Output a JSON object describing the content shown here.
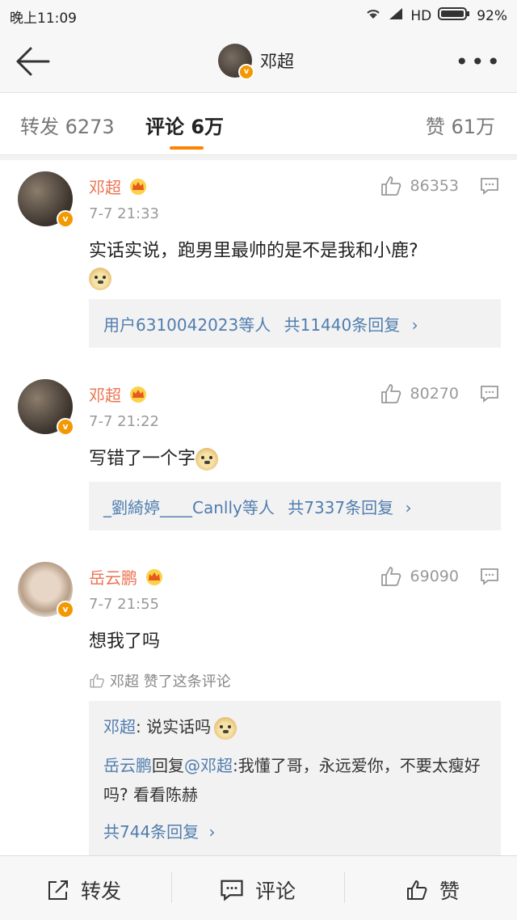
{
  "status": {
    "time": "晚上11:09",
    "network": "HD",
    "battery": "92%"
  },
  "nav": {
    "title": "邓超"
  },
  "tabs": {
    "forward": "转发 6273",
    "comment": "评论 6万",
    "like": "赞 61万"
  },
  "comments": [
    {
      "author": "邓超",
      "time": "7-7 21:33",
      "text": "实话实说，跑男里最帅的是不是我和小鹿?",
      "likes": "86353",
      "replies_summary": {
        "users": "用户6310042023等人",
        "count": "共11440条回复"
      }
    },
    {
      "author": "邓超",
      "time": "7-7 21:22",
      "text": "写错了一个字",
      "likes": "80270",
      "replies_summary": {
        "users": "_劉綺婷____Canlly等人",
        "count": "共7337条回复"
      }
    },
    {
      "author": "岳云鹏",
      "time": "7-7 21:55",
      "text": "想我了吗",
      "likes": "69090",
      "liked_by": "邓超 赞了这条评论",
      "replies": [
        {
          "author": "邓超",
          "sep": ":",
          "text": " 说实话吗"
        },
        {
          "author": "岳云鹏",
          "mid": "回复",
          "target": "@邓超",
          "text": ":我懂了哥，永远爱你，不要太瘦好吗? 看看陈赫"
        }
      ],
      "more": "共744条回复"
    }
  ],
  "bottom": {
    "forward": "转发",
    "comment": "评论",
    "like": "赞"
  },
  "colors": {
    "accent": "#ff8200",
    "name": "#eb7350",
    "link": "#507daf"
  }
}
